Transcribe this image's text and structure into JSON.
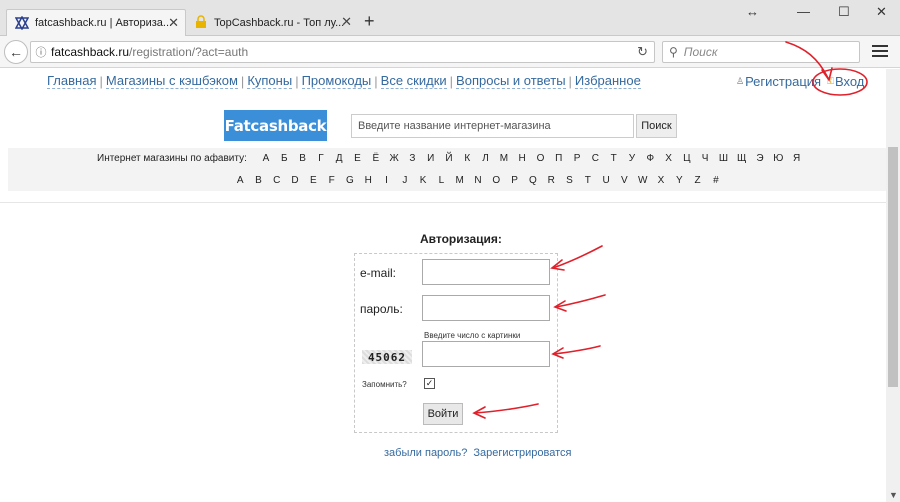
{
  "browser": {
    "tabs": [
      {
        "title": "fatcashback.ru | Авториза...",
        "active": true
      },
      {
        "title": "TopCashback.ru - Топ лу...",
        "active": false
      }
    ],
    "new_tab": "+",
    "window_controls": {
      "minimize": "—",
      "maximize": "☐",
      "close": "✕",
      "resize": "↔"
    },
    "url_host": "fatcashback.ru",
    "url_path": "/registration/?act=auth",
    "search_placeholder": "Поиск"
  },
  "site": {
    "nav": [
      "Главная",
      "Магазины с кэшбэком",
      "Купоны",
      "Промокоды",
      "Все скидки",
      "Вопросы и ответы",
      "Избранное"
    ],
    "register_link": "Регистрация",
    "login_link": "Вход",
    "logo": "Fatcashback",
    "shop_search_placeholder": "Введите название интернет-магазина",
    "shop_search_button": "Поиск",
    "alphabet_label": "Интернет магазины по афавиту:",
    "alphabet_ru": [
      "А",
      "Б",
      "В",
      "Г",
      "Д",
      "Е",
      "Ё",
      "Ж",
      "З",
      "И",
      "Й",
      "К",
      "Л",
      "М",
      "Н",
      "О",
      "П",
      "Р",
      "С",
      "Т",
      "У",
      "Ф",
      "Х",
      "Ц",
      "Ч",
      "Ш",
      "Щ",
      "Э",
      "Ю",
      "Я"
    ],
    "alphabet_en": [
      "A",
      "B",
      "C",
      "D",
      "E",
      "F",
      "G",
      "H",
      "I",
      "J",
      "K",
      "L",
      "M",
      "N",
      "O",
      "P",
      "Q",
      "R",
      "S",
      "T",
      "U",
      "V",
      "W",
      "X",
      "Y",
      "Z",
      "#"
    ]
  },
  "login": {
    "title": "Авторизация:",
    "email_label": "e-mail:",
    "password_label": "пароль:",
    "captcha_hint": "Введите число с картинки",
    "captcha_value": "45062",
    "remember_label": "Запомнить?",
    "remember_checked": true,
    "submit": "Войти",
    "forgot": "забыли пароль?",
    "register": "Зарегистрироватся"
  },
  "colors": {
    "link": "#356a9f",
    "logo_bg": "#3a8fd8",
    "annotation": "#e0202a"
  }
}
